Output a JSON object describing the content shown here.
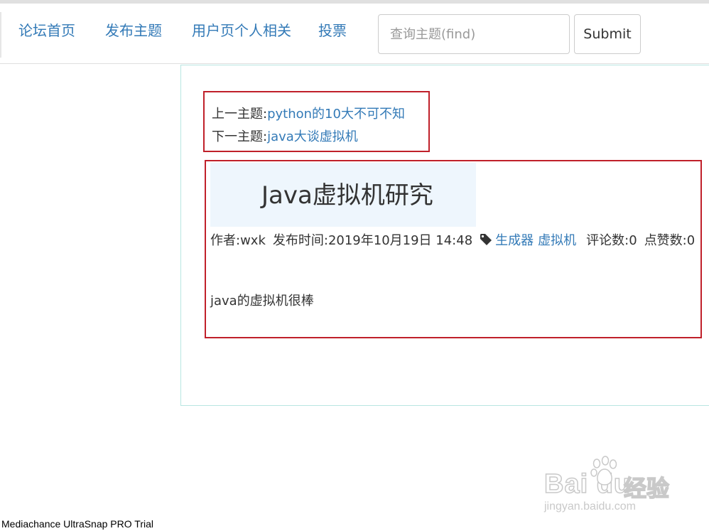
{
  "nav": {
    "links": [
      "论坛首页",
      "发布主题",
      "用户页个人相关",
      "投票"
    ],
    "search_placeholder": "查询主题(find)",
    "search_value": "",
    "submit_label": "Submit"
  },
  "topic_nav": {
    "prev_prefix": "上一主题:",
    "prev_title": "python的10大不可不知",
    "next_prefix": "下一主题:",
    "next_title": "java大谈虚拟机"
  },
  "article": {
    "title": "Java虚拟机研究",
    "author": "作者:wxk",
    "published": "发布时间:2019年10月19日 14:48",
    "tag_icon": "tag-icon",
    "tags": [
      "生成器",
      "虚拟机"
    ],
    "comments": "评论数:0",
    "likes": "点赞数:0",
    "body": "java的虚拟机很棒"
  },
  "watermark": {
    "text": "Mediachance UltraSnap PRO Trial"
  },
  "baidu_jingyan": {
    "logo_word": "Bai du",
    "logo_cn": "经验",
    "url": "jingyan.baidu.com"
  },
  "colors": {
    "link": "#337ab7",
    "highlight_border": "#c0202a",
    "panel_border": "#b8e6e2",
    "title_bg": "#eef6fd"
  }
}
